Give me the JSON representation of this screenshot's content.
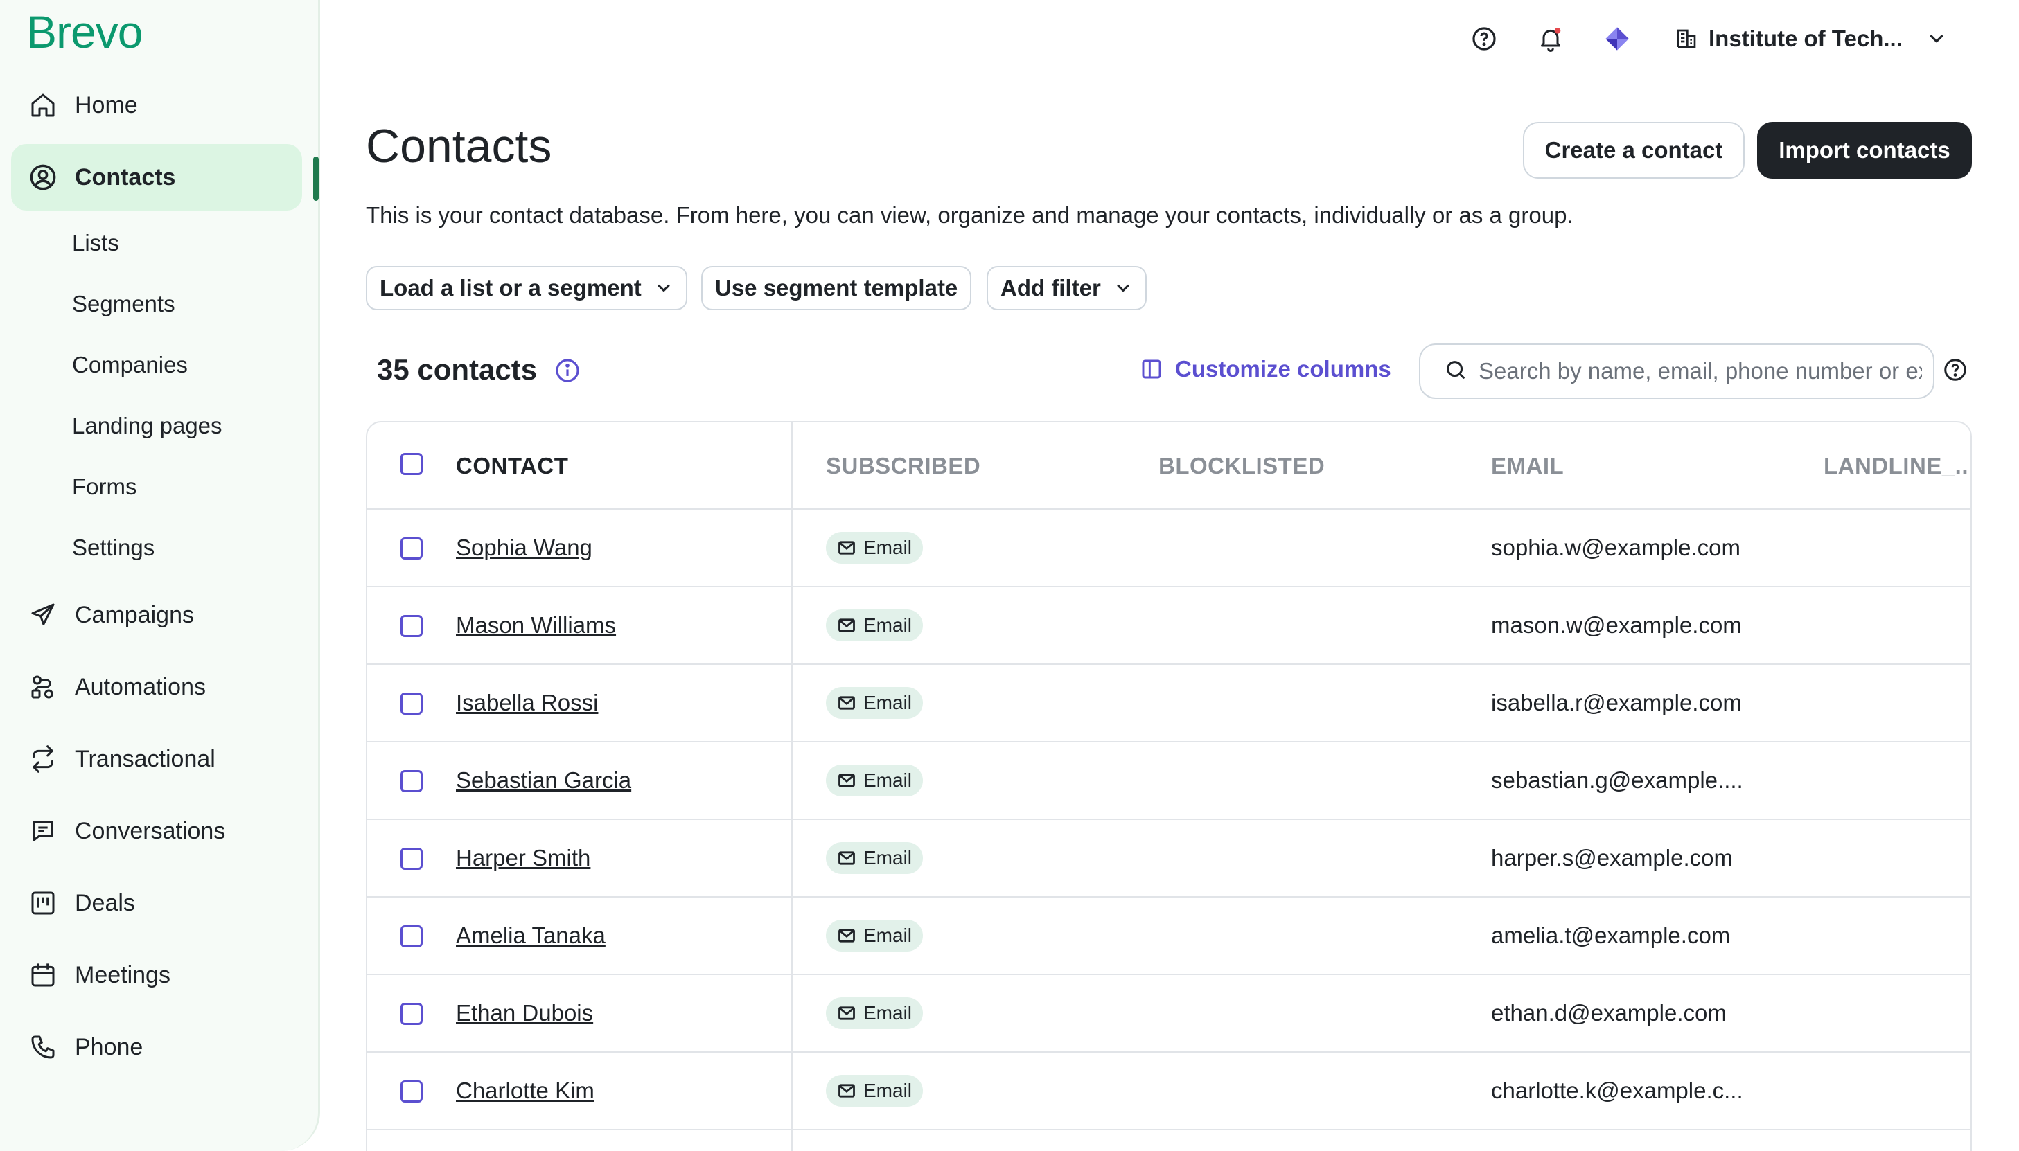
{
  "brand": {
    "logo": "Brevo"
  },
  "sidebar": {
    "items": [
      {
        "label": "Home",
        "icon": "home-icon"
      },
      {
        "label": "Contacts",
        "icon": "user-circle-icon",
        "active": true
      },
      {
        "label": "Campaigns",
        "icon": "paper-plane-icon"
      },
      {
        "label": "Automations",
        "icon": "automation-icon"
      },
      {
        "label": "Transactional",
        "icon": "arrows-cycle-icon"
      },
      {
        "label": "Conversations",
        "icon": "chat-icon"
      },
      {
        "label": "Deals",
        "icon": "kanban-icon"
      },
      {
        "label": "Meetings",
        "icon": "calendar-icon"
      },
      {
        "label": "Phone",
        "icon": "phone-icon"
      }
    ],
    "contacts_sub": [
      "Lists",
      "Segments",
      "Companies",
      "Landing pages",
      "Forms",
      "Settings"
    ]
  },
  "topbar": {
    "org_name": "Institute of Tech..."
  },
  "header": {
    "title": "Contacts",
    "create_label": "Create a contact",
    "import_label": "Import contacts",
    "description": "This is your contact database. From here, you can view, organize and manage your contacts, individually or as a group."
  },
  "filters": {
    "load_list": "Load a list or a segment",
    "segment_template": "Use segment template",
    "add_filter": "Add filter"
  },
  "toolbar": {
    "count": "35 contacts",
    "customize": "Customize columns",
    "search_placeholder": "Search by name, email, phone number or ext. ID"
  },
  "table": {
    "columns": [
      "CONTACT",
      "SUBSCRIBED",
      "BLOCKLISTED",
      "EMAIL",
      "LANDLINE_..."
    ],
    "rows": [
      {
        "name": "Sophia Wang",
        "subscribed": "Email",
        "email": "sophia.w@example.com"
      },
      {
        "name": "Mason Williams",
        "subscribed": "Email",
        "email": "mason.w@example.com"
      },
      {
        "name": "Isabella Rossi",
        "subscribed": "Email",
        "email": "isabella.r@example.com"
      },
      {
        "name": "Sebastian Garcia",
        "subscribed": "Email",
        "email": "sebastian.g@example...."
      },
      {
        "name": "Harper Smith",
        "subscribed": "Email",
        "email": "harper.s@example.com"
      },
      {
        "name": "Amelia Tanaka",
        "subscribed": "Email",
        "email": "amelia.t@example.com"
      },
      {
        "name": "Ethan Dubois",
        "subscribed": "Email",
        "email": "ethan.d@example.com"
      },
      {
        "name": "Charlotte Kim",
        "subscribed": "Email",
        "email": "charlotte.k@example.c..."
      }
    ]
  },
  "colors": {
    "brand_green": "#0b996e",
    "accent_purple": "#5b4fd0",
    "active_bg": "#dcf5e3",
    "badge_bg": "#e2f1ea"
  }
}
